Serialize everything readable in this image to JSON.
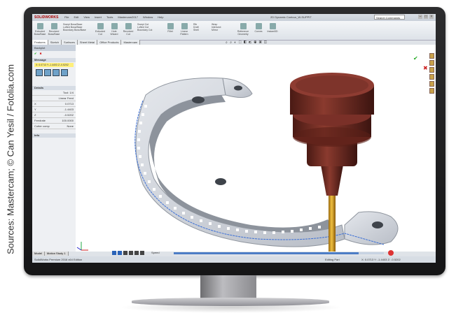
{
  "credit": "Sources: Mastercam; © Can Yesil / Fotolia.com",
  "app": {
    "brand": "SOLIDWORKS",
    "menus": [
      "File",
      "Edit",
      "View",
      "Insert",
      "Tools",
      "Mastercam2017",
      "Window",
      "Help"
    ],
    "window_title": "2D Dynamic Contour_W-SUPPIT",
    "search_placeholder": "Search Commands"
  },
  "ribbon": {
    "buttons": [
      "Extruded Boss/Base",
      "Revolved Boss/Base",
      "Swept Boss/Base",
      "Lofted Boss/Base",
      "Boundary Boss/Base",
      "Extruded Cut",
      "Hole Wizard",
      "Revolved Cut",
      "Swept Cut",
      "Lofted Cut",
      "Boundary Cut",
      "Fillet",
      "Linear Pattern",
      "Rib",
      "Draft",
      "Shell",
      "Wrap",
      "Intersect",
      "Mirror",
      "Reference Geometry",
      "Curves",
      "Instant3D"
    ]
  },
  "command_tabs": [
    "Features",
    "Sketch",
    "Surfaces",
    "Sheet Metal",
    "Office Products",
    "Mastercam"
  ],
  "property_manager": {
    "title": "Backplot",
    "ok_glyph": "✔",
    "cancel_glyph": "✖",
    "section_message": "Message",
    "message": "X: 0.0713  Y:-1.4403  Z:-0.5202",
    "section_details": "Details",
    "details": [
      {
        "label": "",
        "value": "Tool: 1/4"
      },
      {
        "label": "",
        "value": "Linear Feed"
      },
      {
        "label": "X",
        "value": "0.0713"
      },
      {
        "label": "Y",
        "value": "-1.4403"
      },
      {
        "label": "Z",
        "value": "-0.5202"
      },
      {
        "label": "Feedrate",
        "value": "100.0000"
      },
      {
        "label": "Cutter comp",
        "value": "None"
      }
    ],
    "section_info": "Info"
  },
  "playback": {
    "speed": "Speed",
    "progress": 0.88
  },
  "bottom_tabs": [
    "Model",
    "Motion Study 1"
  ],
  "status": {
    "left": "SolidWorks Premium 2016 x64 Edition",
    "middle": "Editing Part",
    "right": "X: 0.0713  Y: -1.4403  Z: -0.5202"
  },
  "colors": {
    "part": "#c4c9d1",
    "toolpath": "#3b6fd6",
    "holder": "#6b2a22",
    "tool": "#d4a020"
  }
}
